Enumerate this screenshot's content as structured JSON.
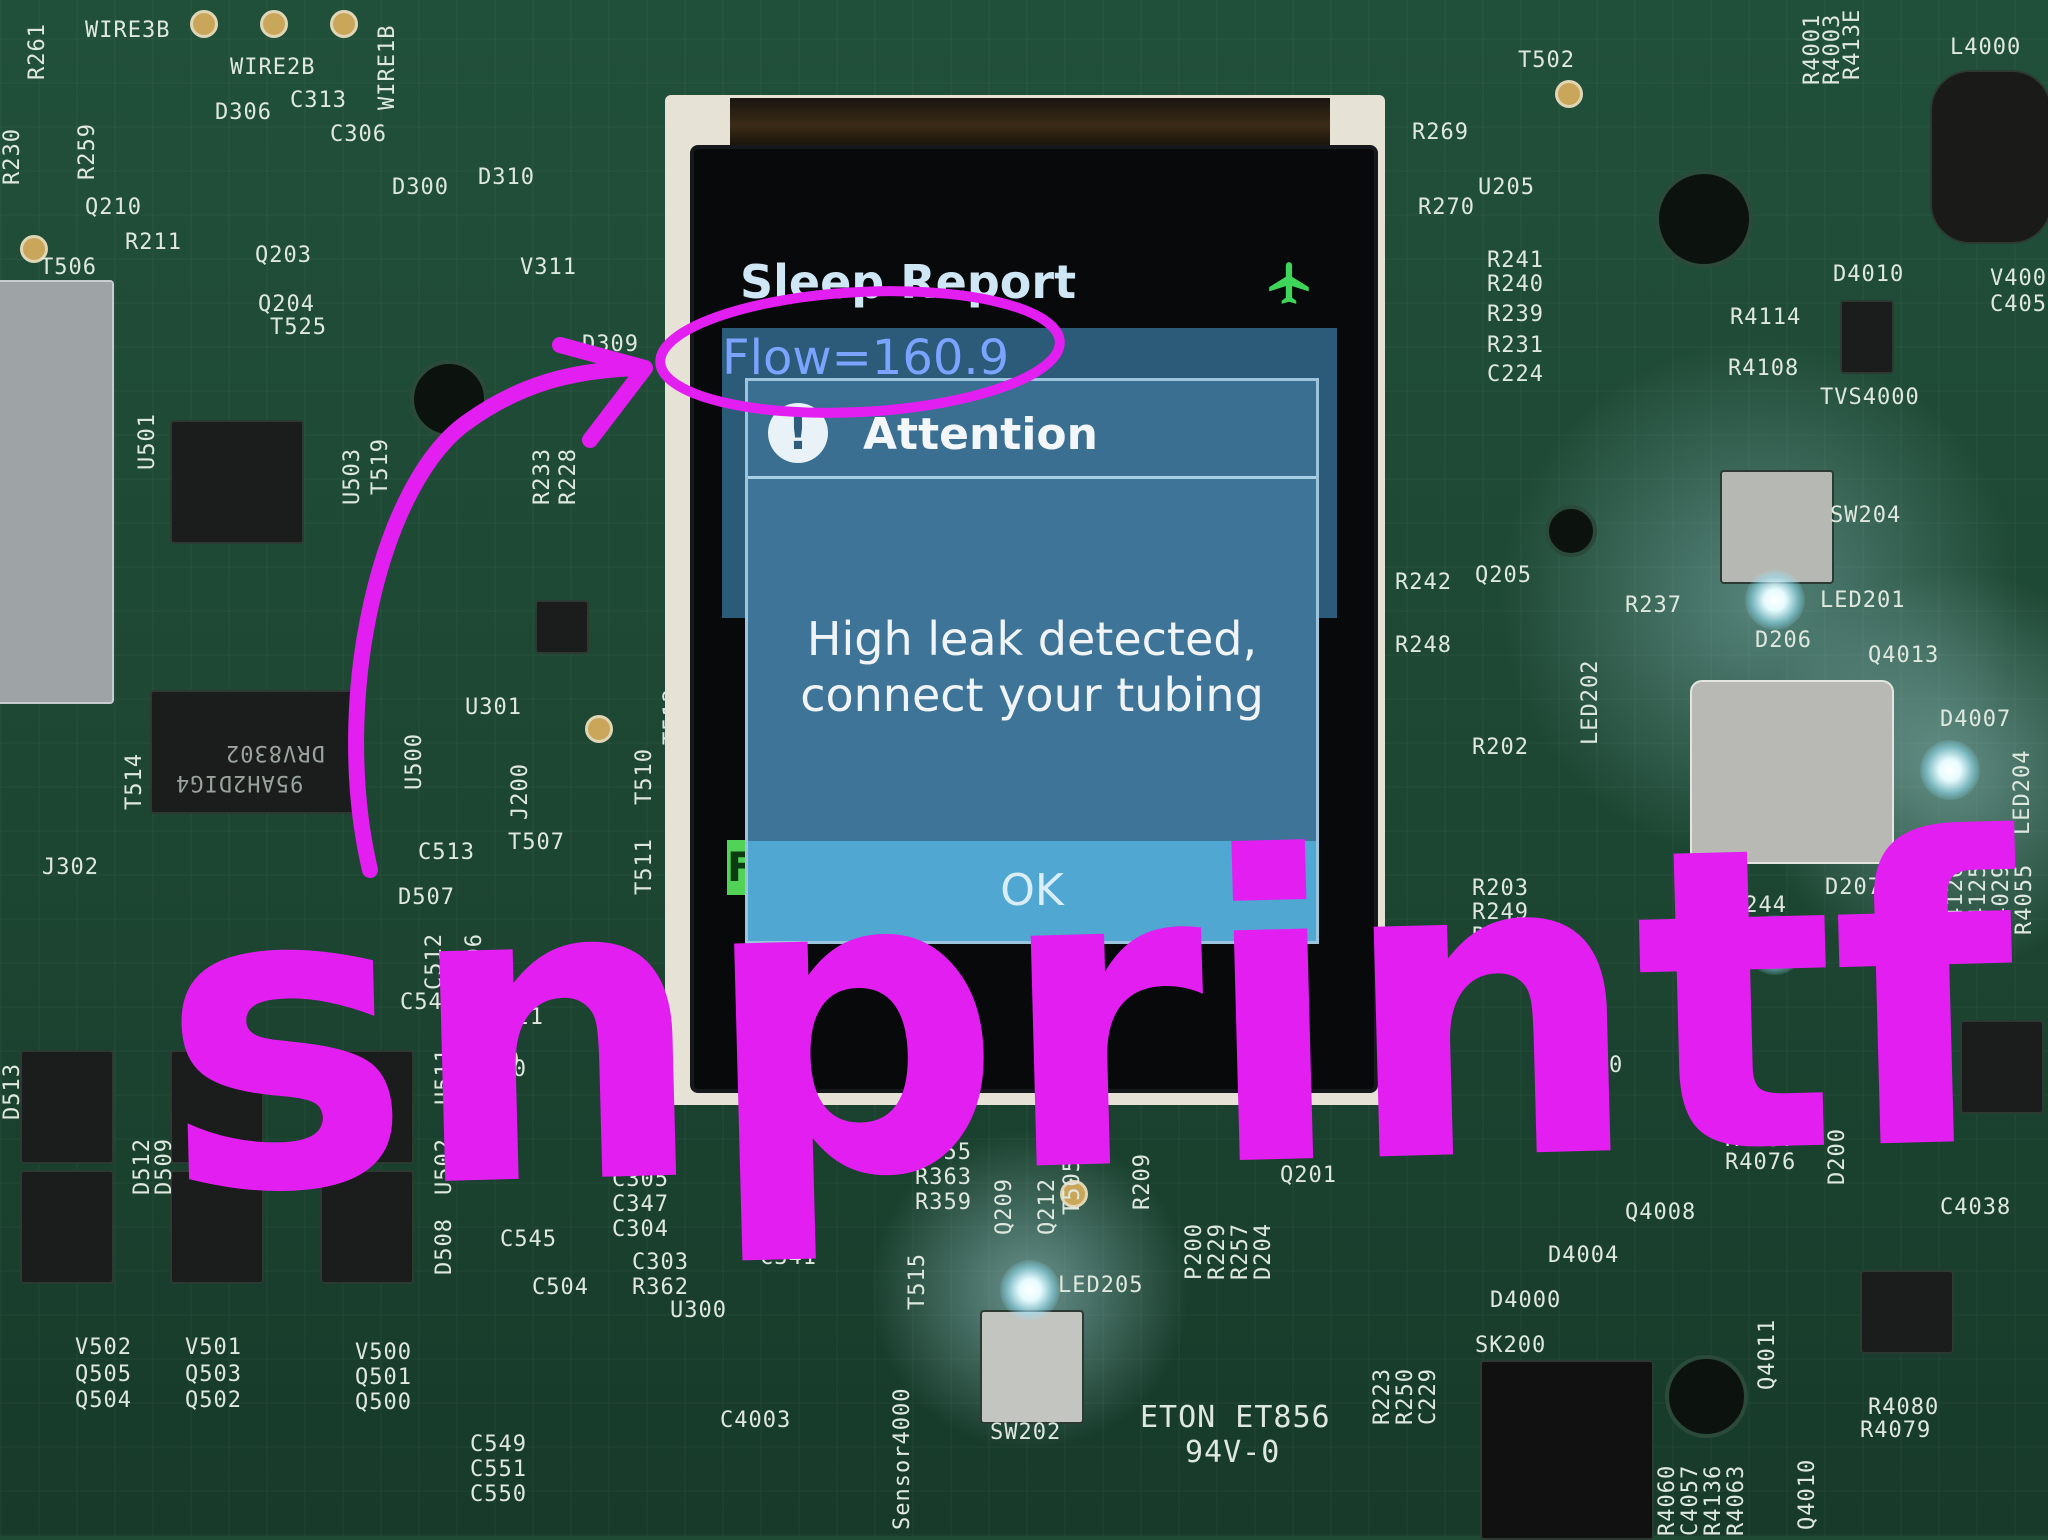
{
  "device_screen": {
    "header_title": "Sleep Report",
    "status_icon": "airplane-icon",
    "flow_readout": "Flow=160.9",
    "left_strip_label": "F",
    "dialog": {
      "icon": "info-icon",
      "title": "Attention",
      "message": "High leak detected,\nconnect your tubing",
      "ok_label": "OK"
    }
  },
  "annotation": {
    "handwritten_text": "snprintf",
    "color": "#e21ff0"
  },
  "board_labels": {
    "top_left": [
      "WIRE3B",
      "WIRE2B",
      "WIRE1B",
      "R261",
      "R230",
      "R259",
      "D306",
      "C313",
      "C306",
      "Q210",
      "R211",
      "D300",
      "D310",
      "Q203",
      "T506",
      "Q204",
      "T525",
      "V311",
      "D309",
      "U501",
      "U503",
      "T519",
      "R233",
      "R228"
    ],
    "top_right": [
      "T502",
      "R269",
      "U205",
      "R270",
      "R241",
      "R240",
      "R239",
      "R231",
      "C224",
      "D4010",
      "R4114",
      "R4108",
      "TVS4000",
      "SW204",
      "R242",
      "Q205",
      "R248",
      "R237",
      "LED201",
      "D206",
      "Q4013",
      "LED202",
      "D4007",
      "LED204"
    ],
    "middle": [
      "U301",
      "J200",
      "T507",
      "T510",
      "T512",
      "T511",
      "C513",
      "D507",
      "D506",
      "C512",
      "J302",
      "T514",
      "U500",
      "C548",
      "T520",
      "T521",
      "T518",
      "U511",
      "U502"
    ],
    "bottom": [
      "D513",
      "D512",
      "D509",
      "D508",
      "C545",
      "C504",
      "V502",
      "V501",
      "V500",
      "Q505",
      "Q504",
      "Q503",
      "Q502",
      "Q501",
      "Q500",
      "C346",
      "C305",
      "C347",
      "C304",
      "C303",
      "R362",
      "U300",
      "C341",
      "C355",
      "R363",
      "R359",
      "Q209",
      "Q212",
      "T505",
      "R209",
      "Q201",
      "P200",
      "R229",
      "R257",
      "D204",
      "T515",
      "LED205",
      "SW202",
      "C4003",
      "Sensor4000",
      "ETON ET856",
      "94V-0",
      "R223",
      "R250",
      "C229",
      "SK200",
      "D4004",
      "D4000",
      "Q4008",
      "R4056",
      "R4057",
      "R4076",
      "D200",
      "Q4011",
      "R4080",
      "R4079",
      "C549",
      "C551",
      "C550"
    ],
    "right_edge": [
      "R4001",
      "R4003",
      "R413E",
      "L4000",
      "V400",
      "C405",
      "R4109",
      "R4126",
      "R4125",
      "C4029",
      "R4055",
      "D207",
      "R244",
      "R202",
      "R203",
      "R249",
      "R235",
      "C4010",
      "T503",
      "C4038",
      "R4060",
      "C4057",
      "R4136",
      "R4063",
      "Q4010"
    ],
    "chips": [
      "95AH2DIG4",
      "DRV8302"
    ]
  }
}
